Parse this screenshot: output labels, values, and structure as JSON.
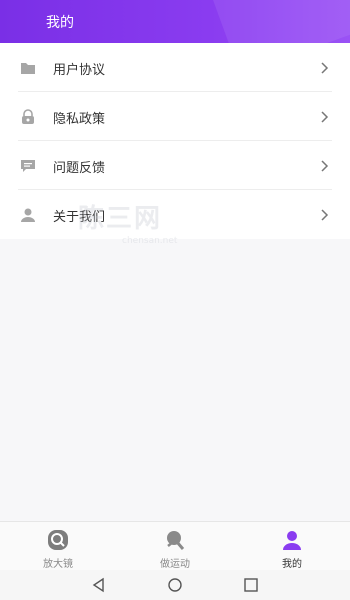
{
  "header": {
    "title": "我的"
  },
  "menu": {
    "items": [
      {
        "label": "用户协议",
        "icon": "folder-icon"
      },
      {
        "label": "隐私政策",
        "icon": "lock-icon"
      },
      {
        "label": "问题反馈",
        "icon": "message-icon"
      },
      {
        "label": "关于我们",
        "icon": "user-icon"
      }
    ]
  },
  "watermark": {
    "text": "陈三网",
    "sub": "chensan.net"
  },
  "tabbar": {
    "tabs": [
      {
        "label": "放大镜",
        "icon": "magnifier-icon"
      },
      {
        "label": "做运动",
        "icon": "sport-icon"
      },
      {
        "label": "我的",
        "icon": "person-icon",
        "active": true
      }
    ]
  },
  "colors": {
    "accent": "#8a3cf0",
    "icon_gray": "#a6a6a6"
  },
  "system_nav": {
    "icons": [
      "back-icon",
      "home-icon",
      "recents-icon"
    ]
  }
}
